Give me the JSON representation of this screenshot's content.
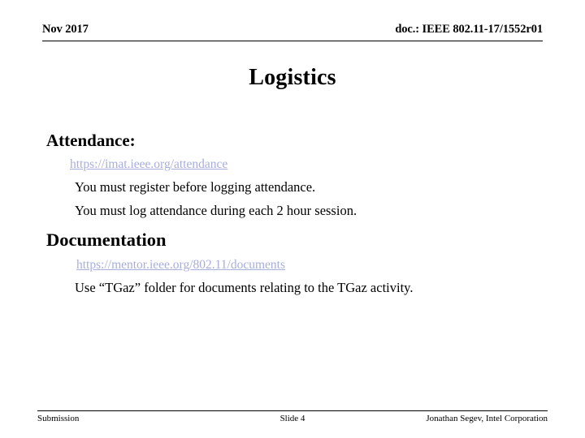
{
  "header": {
    "date": "Nov 2017",
    "doc_reference": "doc.: IEEE 802.11-17/1552r01"
  },
  "title": "Logistics",
  "content": {
    "attendance": {
      "heading": "Attendance:",
      "link_text": "https://imat.ieee.org/attendance",
      "bullets": [
        "You must register before logging attendance.",
        "You must log attendance during each 2 hour session."
      ]
    },
    "documentation": {
      "heading": "Documentation",
      "link_text": "https://mentor.ieee.org/802.11/documents",
      "bullets": [
        "Use “TGaz” folder for documents relating to the TGaz activity."
      ]
    }
  },
  "footer": {
    "left": "Submission",
    "center": "Slide 4",
    "right": "Jonathan Segev, Intel Corporation"
  },
  "colors": {
    "text": "#000000",
    "link": "#a8aedb",
    "background": "#ffffff",
    "rule": "#000000"
  }
}
